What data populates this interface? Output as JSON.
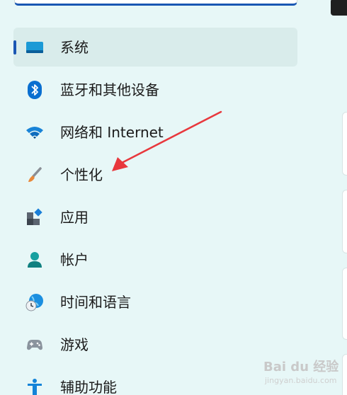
{
  "sidebar": {
    "items": [
      {
        "label": "系统",
        "icon": "display-icon",
        "selected": true
      },
      {
        "label": "蓝牙和其他设备",
        "icon": "bluetooth-icon"
      },
      {
        "label": "网络和 Internet",
        "icon": "wifi-icon"
      },
      {
        "label": "个性化",
        "icon": "brush-icon"
      },
      {
        "label": "应用",
        "icon": "apps-icon"
      },
      {
        "label": "帐户",
        "icon": "person-icon"
      },
      {
        "label": "时间和语言",
        "icon": "globe-clock-icon"
      },
      {
        "label": "游戏",
        "icon": "gamepad-icon"
      },
      {
        "label": "辅助功能",
        "icon": "accessibility-icon"
      }
    ]
  },
  "annotation": {
    "type": "arrow",
    "color": "#e8383d",
    "points_to": "个性化"
  },
  "watermark": {
    "brand": "Bai du 经验",
    "sub": "jingyan.baidu.com"
  },
  "colors": {
    "background": "#e7f7f7",
    "selected_bg": "#d9eceb",
    "accent": "#1a57b3"
  }
}
